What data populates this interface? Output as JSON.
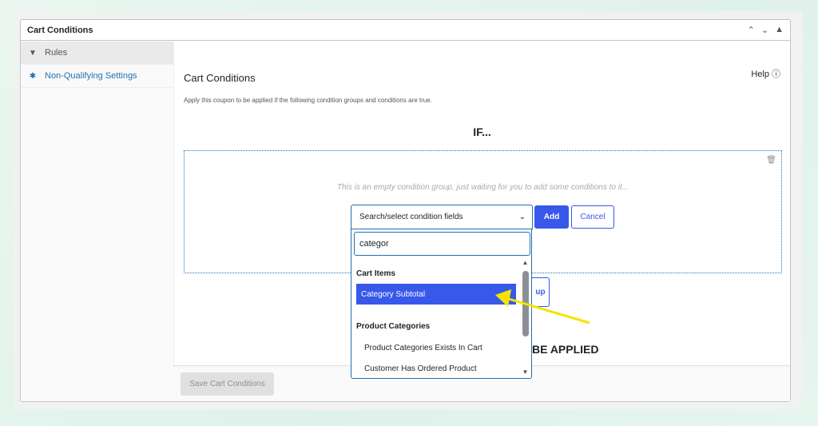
{
  "panel": {
    "title": "Cart Conditions",
    "controls": [
      "^",
      "v",
      "▲"
    ]
  },
  "tabs": [
    {
      "label": "Rules",
      "icon": "funnel-icon"
    },
    {
      "label": "Non-Qualifying Settings",
      "icon": "gear-icon"
    }
  ],
  "main": {
    "title": "Cart Conditions",
    "help": "Help",
    "description": "Apply this coupon to be applied if the following condition groups and conditions are true.",
    "if_label": "IF...",
    "empty_group_message": "This is an empty condition group, just waiting for you to add some conditions to it..."
  },
  "condition_select": {
    "placeholder": "Search/select condition fields",
    "search_value": "categor",
    "add_label": "Add",
    "cancel_label": "Cancel",
    "groups": [
      {
        "label": "Cart Items",
        "options": [
          "Category Subtotal"
        ]
      },
      {
        "label": "Product Categories",
        "options": [
          "Product Categories Exists In Cart",
          "Customer Has Ordered Product"
        ]
      }
    ],
    "selected": "Category Subtotal"
  },
  "partial_button_label": "up",
  "be_applied_label": "BE APPLIED",
  "footer": {
    "save_label": "Save Cart Conditions"
  },
  "colors": {
    "accent": "#3858e9",
    "link": "#2271b1",
    "annotation_arrow": "#f5e300"
  }
}
